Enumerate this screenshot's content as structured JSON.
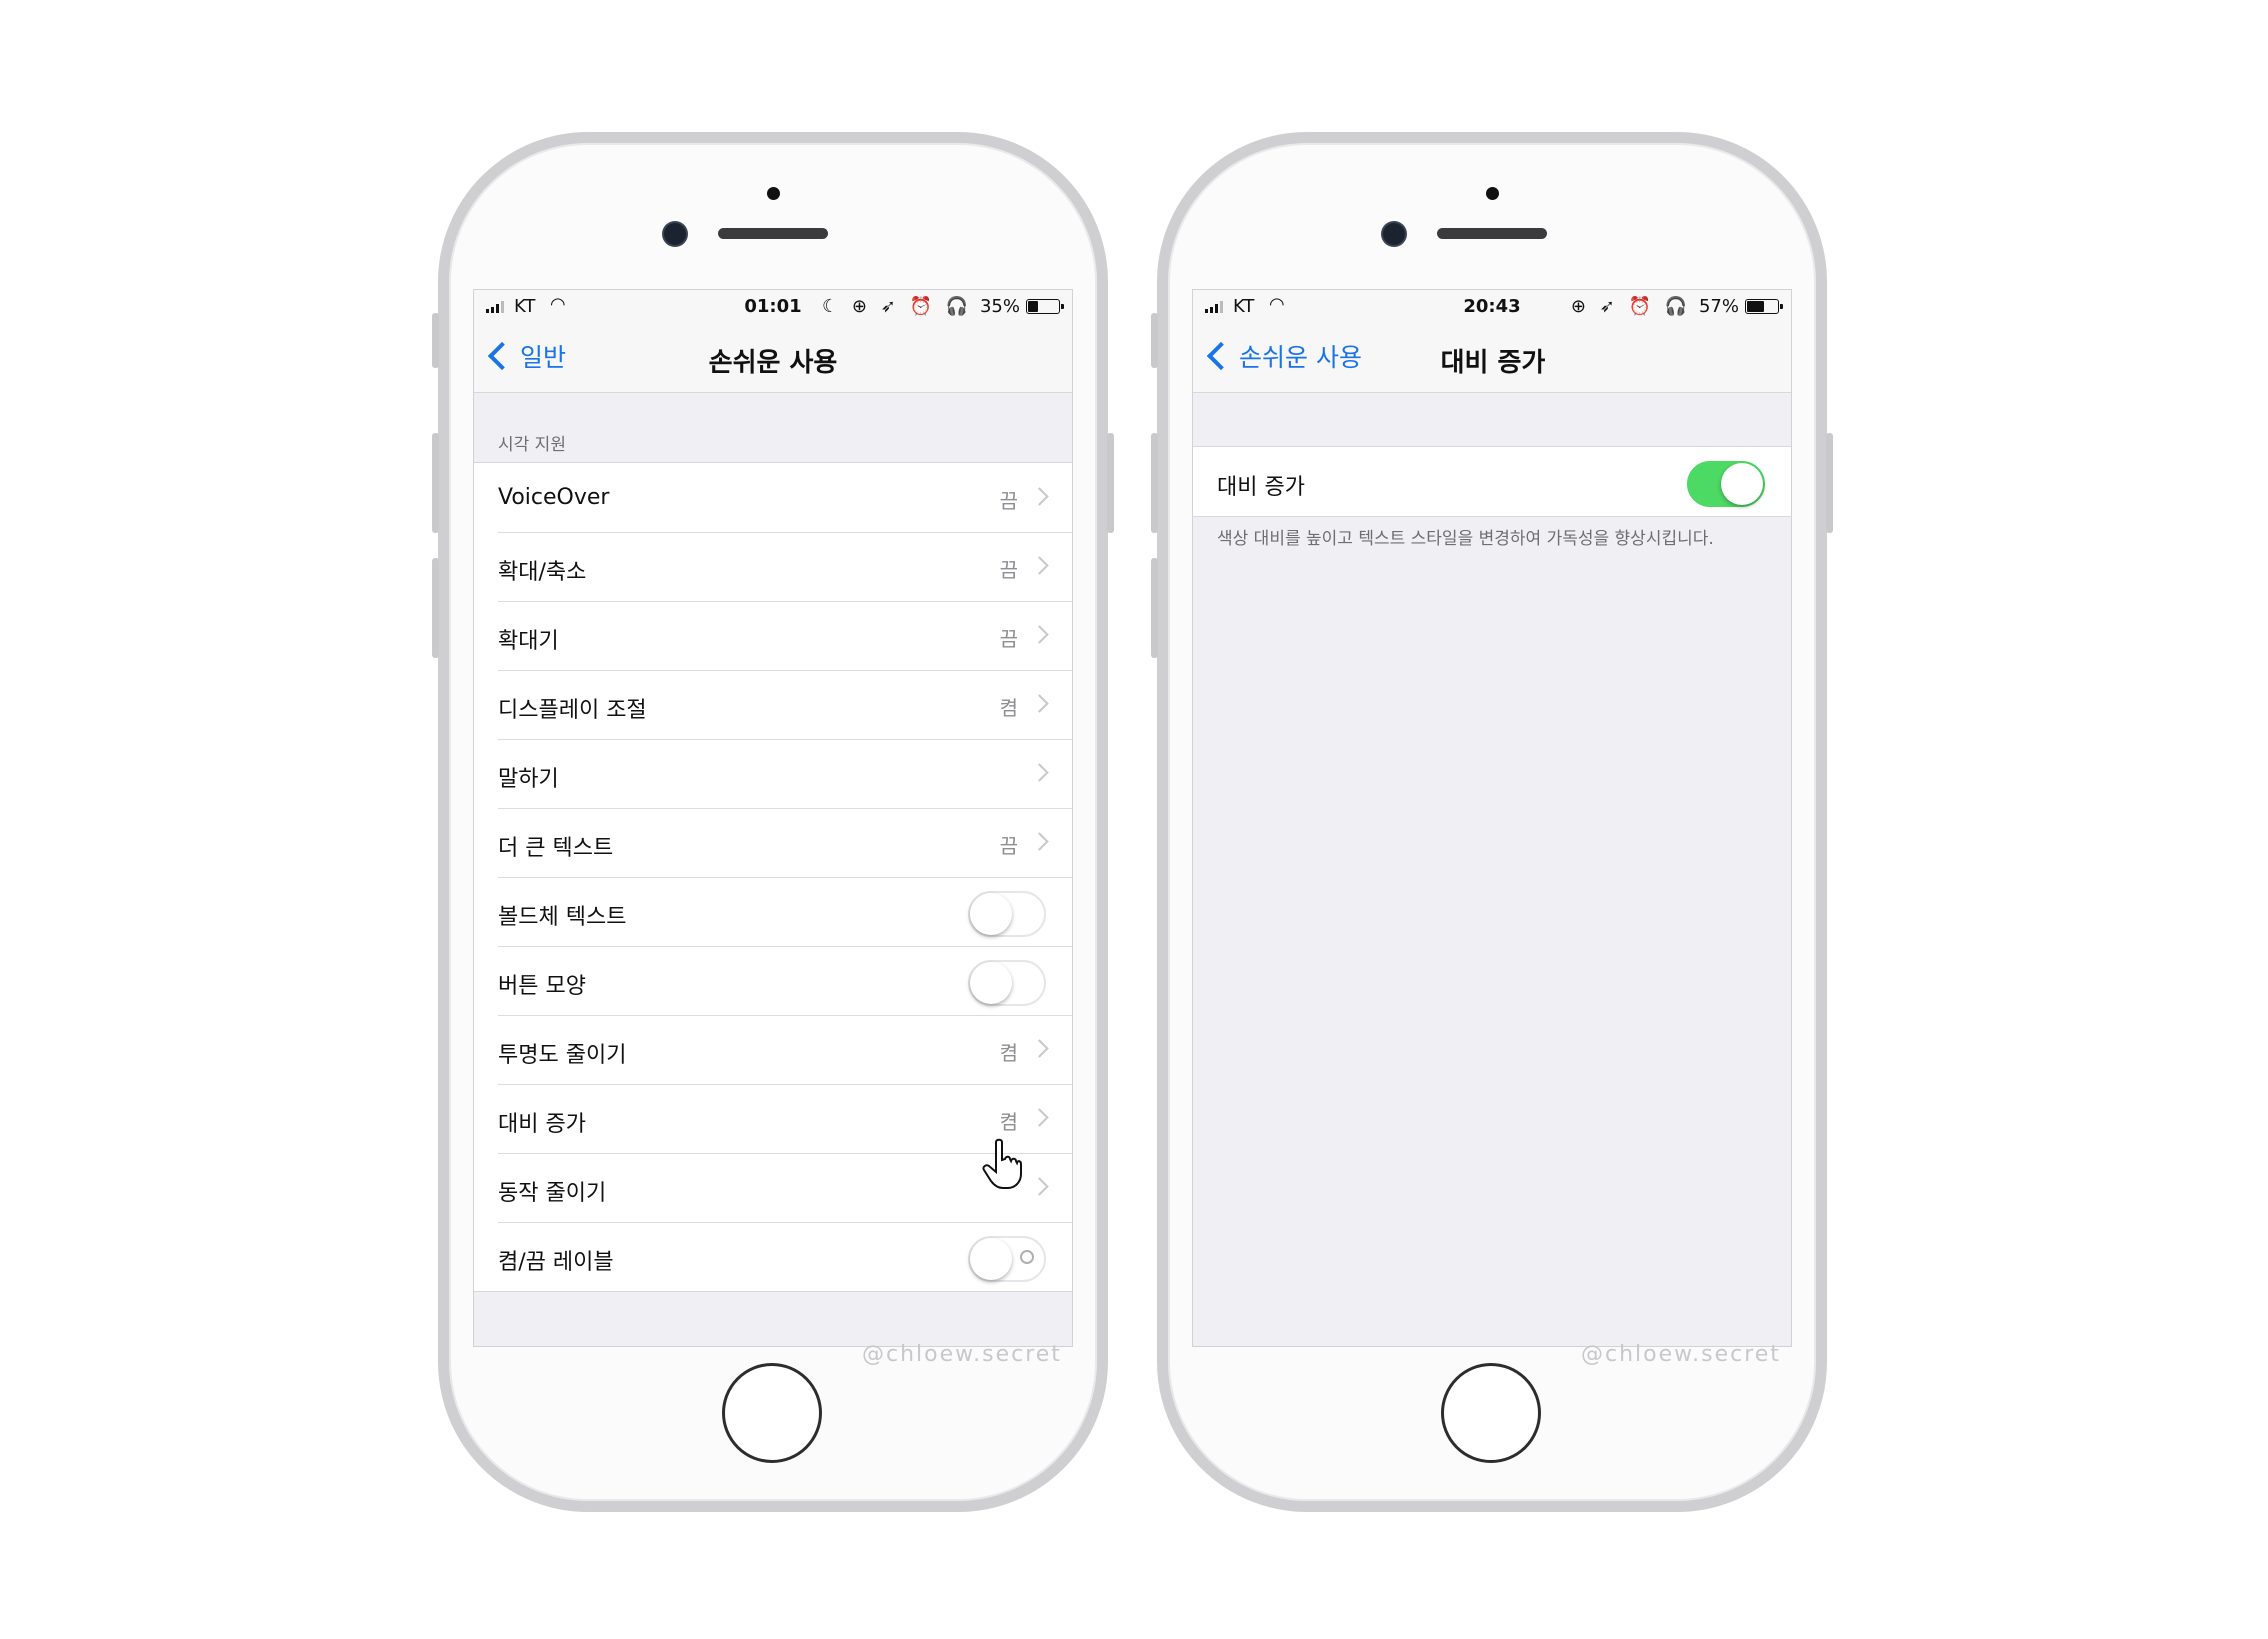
{
  "left_phone": {
    "status": {
      "carrier": "KT",
      "time": "01:01",
      "icons": "☾ ⊕ ➶ ⏰ 🎧",
      "battery": "35%",
      "battery_level": 0.35
    },
    "nav": {
      "back_label": "일반",
      "title": "손쉬운 사용"
    },
    "section_header": "시각 지원",
    "rows": [
      {
        "label": "VoiceOver",
        "value": "끔"
      },
      {
        "label": "확대/축소",
        "value": "끔"
      },
      {
        "label": "확대기",
        "value": "끔"
      },
      {
        "label": "디스플레이 조절",
        "value": "켬"
      },
      {
        "label": "말하기",
        "value": ""
      },
      {
        "label": "더 큰 텍스트",
        "value": "끔"
      },
      {
        "label": "볼드체 텍스트",
        "toggle": false
      },
      {
        "label": "버튼 모양",
        "toggle": false
      },
      {
        "label": "투명도 줄이기",
        "value": "켬"
      },
      {
        "label": "대비 증가",
        "value": "켬"
      },
      {
        "label": "동작 줄이기",
        "value": ""
      },
      {
        "label": "켬/끔 레이블",
        "toggle": false
      }
    ],
    "watermark": "@chloew.secret"
  },
  "right_phone": {
    "status": {
      "carrier": "KT",
      "time": "20:43",
      "icons": "⊕ ➶ ⏰ 🎧",
      "battery": "57%",
      "battery_level": 0.57
    },
    "nav": {
      "back_label": "손쉬운 사용",
      "title": "대비 증가"
    },
    "row_label": "대비 증가",
    "toggle_on": true,
    "footer": "색상 대비를 높이고 텍스트 스타일을 변경하여 가독성을 향상시킵니다.",
    "watermark": "@chloew.secret"
  },
  "colors": {
    "accent": "#1a73e8",
    "toggle_on": "#4cd964"
  }
}
